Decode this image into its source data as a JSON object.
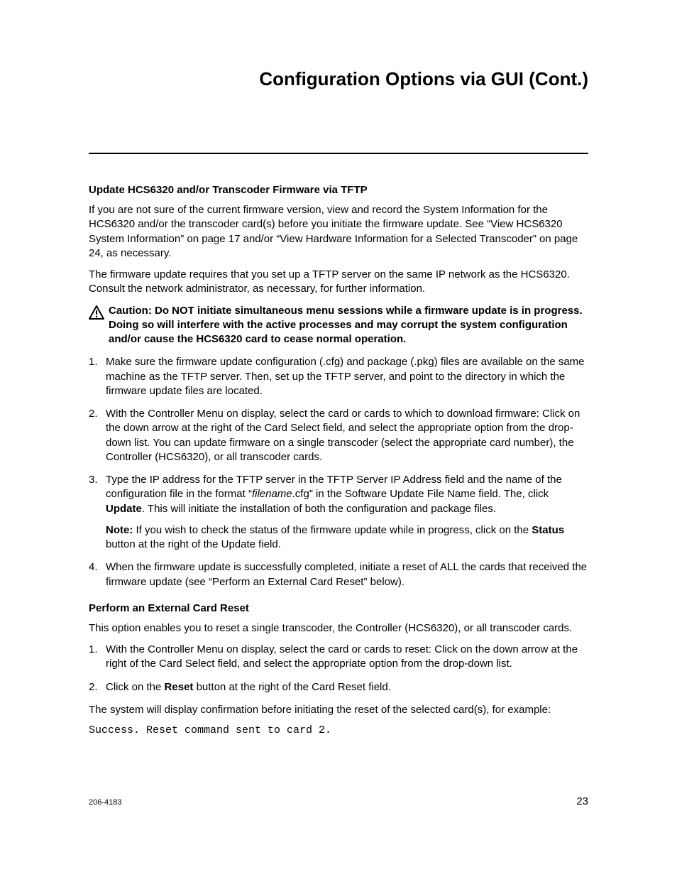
{
  "title": "Configuration Options via GUI (Cont.)",
  "sections": {
    "update_firmware": {
      "heading": "Update HCS6320 and/or Transcoder Firmware via TFTP",
      "p1": "If you are not sure of the current firmware version, view and record the System Information for the HCS6320 and/or the transcoder card(s) before you initiate the firmware update. See “View HCS6320 System Information” on page 17 and/or “View Hardware Information for a Selected Transcoder” on page 24, as necessary.",
      "p2": "The firmware update requires that you set up a TFTP server on the same IP network as the HCS6320. Consult the network administrator, as necessary, for further information.",
      "caution": "Caution: Do NOT initiate simultaneous menu sessions while a firmware update is in progress. Doing so will interfere with the active processes and may corrupt the system configuration and/or cause the HCS6320 card to cease normal operation.",
      "steps": {
        "s1": "Make sure the firmware update configuration (.cfg) and package (.pkg) files are available on the same machine as the TFTP server. Then, set up the TFTP server, and point to the directory in which the firmware update files are located.",
        "s2": "With the Controller Menu on display, select the card or cards to which to download firmware: Click on the down arrow at the right of the Card Select field, and select the appropriate option from the drop-down list. You can update firmware on a single transcoder (select the appropriate card number), the Controller (HCS6320), or all transcoder cards.",
        "s3_a": "Type the IP address for the TFTP server in the TFTP Server IP Address field and the name of the configuration file in the format “",
        "s3_filename": "filename",
        "s3_b": ".cfg” in the Software Update File Name field. The, click ",
        "s3_update": "Update",
        "s3_c": ". This will initiate the installation of both the configuration and package files.",
        "s3_note_label": "Note:",
        "s3_note_a": " If you wish to check the status of the firmware update while in progress, click on the ",
        "s3_status": "Status",
        "s3_note_b": " button at the right of the Update field.",
        "s4": "When the firmware update is successfully completed, initiate a reset of ALL the cards that received the firmware update (see “Perform an External Card Reset” below)."
      }
    },
    "card_reset": {
      "heading": "Perform an External Card Reset",
      "p1": "This option enables you to reset a single transcoder, the Controller (HCS6320), or all transcoder cards.",
      "steps": {
        "s1": "With the Controller Menu on display, select the card or cards to reset: Click on the down arrow at the right of the Card Select field, and select the appropriate option from the drop-down list.",
        "s2_a": "Click on the ",
        "s2_reset": "Reset",
        "s2_b": " button at the right of the Card Reset field."
      },
      "p2": "The system will display confirmation before initiating the reset of the selected card(s), for example:",
      "code": "Success. Reset command sent to card 2."
    }
  },
  "footer": {
    "left": "206-4183",
    "right": "23"
  },
  "list_numbers": {
    "n1": "1.",
    "n2": "2.",
    "n3": "3.",
    "n4": "4."
  }
}
